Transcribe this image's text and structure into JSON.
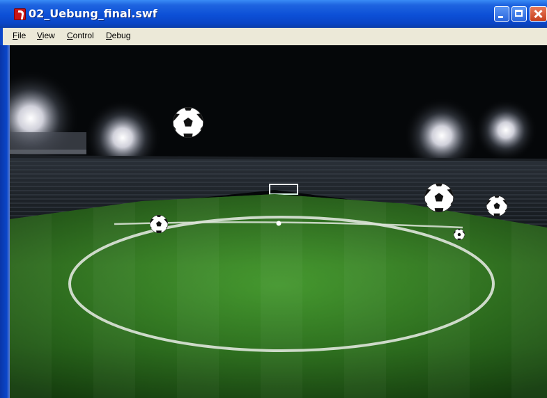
{
  "window": {
    "title": "02_Uebung_final.swf",
    "app_icon": "flash-player-icon",
    "controls": {
      "minimize": "minimize-icon",
      "maximize": "maximize-icon",
      "close": "close-icon"
    }
  },
  "menubar": {
    "items": [
      {
        "label": "File"
      },
      {
        "label": "View"
      },
      {
        "label": "Control"
      },
      {
        "label": "Debug"
      }
    ]
  },
  "scene": {
    "description_icon": "soccer-stadium-night",
    "colors": {
      "sky": "#05070a",
      "pitch_light": "#3f8f2a",
      "pitch_dark": "#1c4a12",
      "line": "#dfe6dc",
      "titlebar": "#0c4fd6",
      "menubar": "#ece9d8"
    },
    "balls": [
      {
        "name": "soccer-ball-1"
      },
      {
        "name": "soccer-ball-2"
      },
      {
        "name": "soccer-ball-3"
      },
      {
        "name": "soccer-ball-4"
      },
      {
        "name": "soccer-ball-5"
      },
      {
        "name": "soccer-ball-6"
      }
    ]
  }
}
